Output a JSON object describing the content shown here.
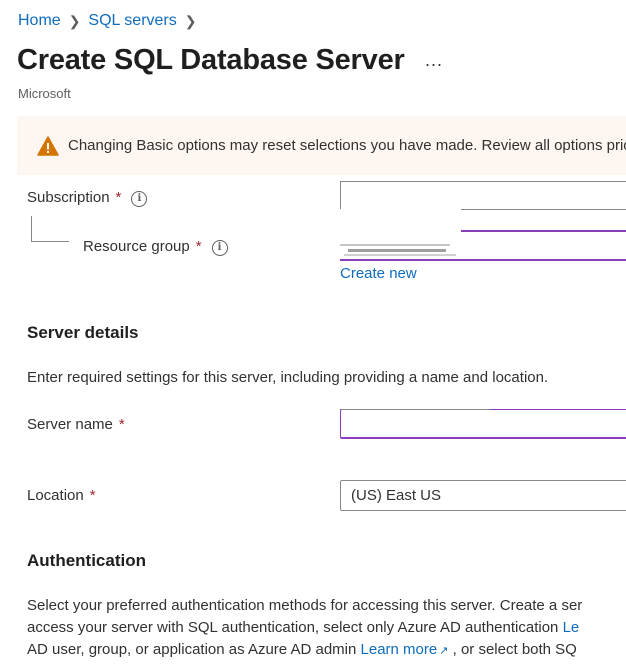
{
  "breadcrumb": {
    "items": [
      "Home",
      "SQL servers"
    ],
    "separator": ">"
  },
  "header": {
    "title": "Create SQL Database Server",
    "more": "...",
    "publisher": "Microsoft"
  },
  "warning": {
    "icon": "warning-icon",
    "text": "Changing Basic options may reset selections you have made. Review all options prio"
  },
  "project": {
    "subscription_label": "Subscription",
    "resource_group_label": "Resource group",
    "required_mark": "*",
    "create_new": "Create new"
  },
  "server_details": {
    "heading": "Server details",
    "description": "Enter required settings for this server, including providing a name and location.",
    "server_name_label": "Server name",
    "server_name_value": "",
    "location_label": "Location",
    "location_value": "(US) East US"
  },
  "authentication": {
    "heading": "Authentication",
    "line1": "Select your preferred authentication methods for accessing this server. Create a ser",
    "line2_prefix": "access your server with SQL authentication, select only Azure AD authentication ",
    "line2_link": "Le",
    "line3_prefix": "AD user, group, or application as Azure AD admin ",
    "line3_link": "Learn more",
    "line3_suffix": " , or select both SQ"
  },
  "colors": {
    "link": "#0f6cbd",
    "required": "#a4262c",
    "warning_bg": "#fdf6f1",
    "warning_icon": "#d47500",
    "focus_underline": "#8a3fb8"
  }
}
